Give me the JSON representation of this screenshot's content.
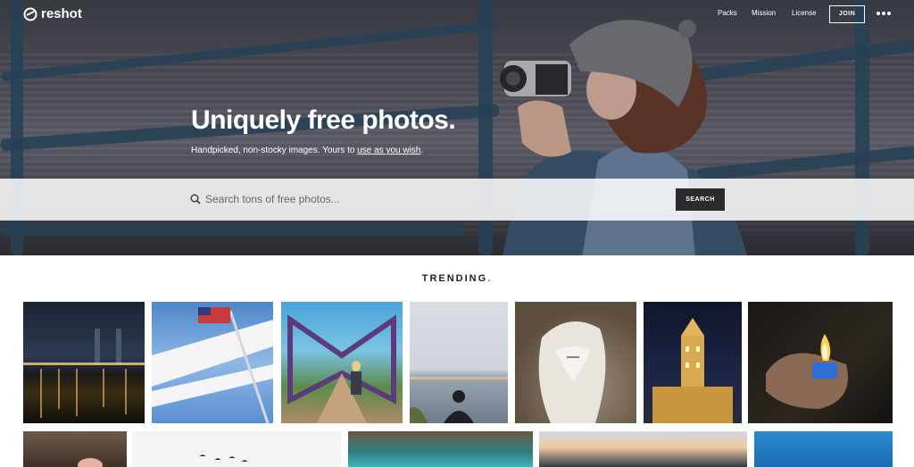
{
  "brand": {
    "name": "reshot"
  },
  "nav": {
    "packs": "Packs",
    "mission": "Mission",
    "license": "License",
    "join": "JOIN"
  },
  "hero": {
    "headline": "Uniquely free photos.",
    "subline_prefix": "Handpicked, non-stocky images. Yours to ",
    "subline_link": "use as you wish",
    "subline_suffix": "."
  },
  "search": {
    "placeholder": "Search tons of free photos...",
    "button": "SEARCH"
  },
  "trending": {
    "title": "TRENDING",
    "dot": "."
  },
  "colors": {
    "accent_dot": "#e23a3a",
    "search_button": "#2b2b2b"
  }
}
